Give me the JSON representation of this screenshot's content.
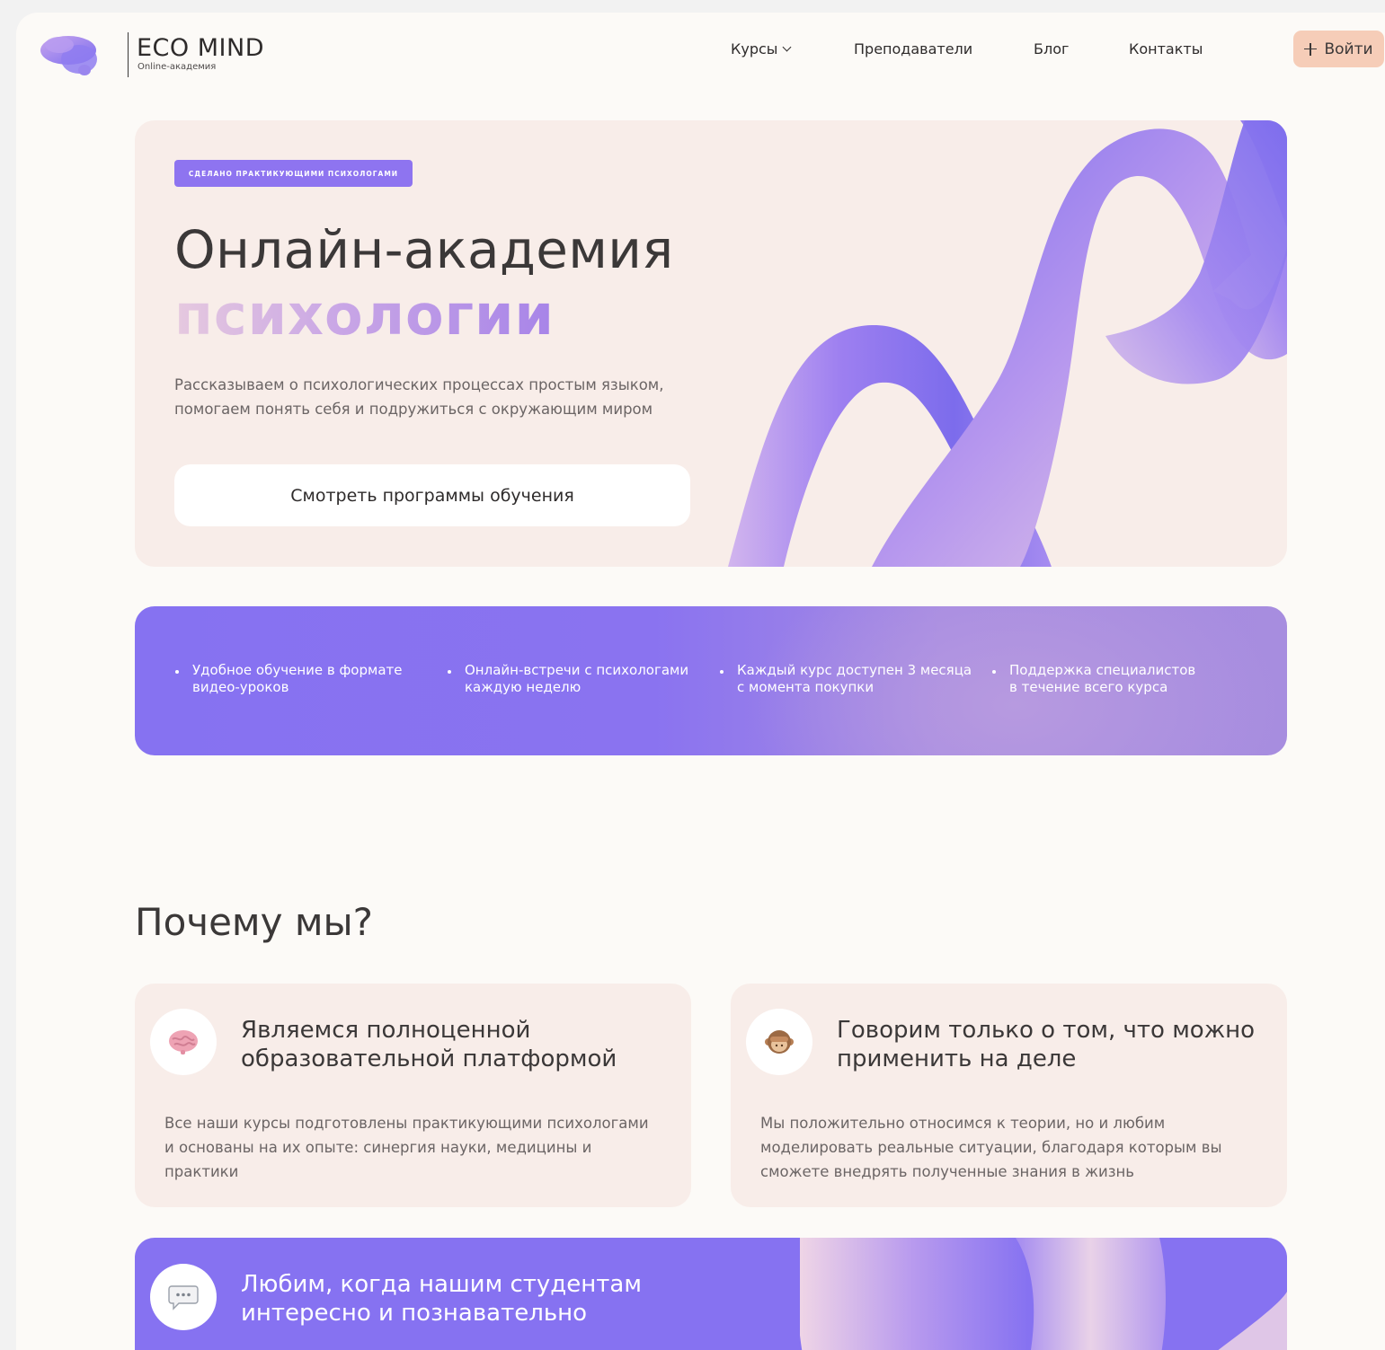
{
  "brand": {
    "name": "ECO MIND",
    "tagline": "Online-академия"
  },
  "nav": {
    "courses": "Курсы",
    "teachers": "Преподаватели",
    "blog": "Блог",
    "contacts": "Контакты",
    "login": "Войти"
  },
  "hero": {
    "badge": "СДЕЛАНО ПРАКТИКУЮЩИМИ ПСИХОЛОГАМИ",
    "title": "Онлайн-академия",
    "title_accent": "психологии",
    "description": [
      "Рассказываем о психологических процессах простым языком,",
      "помогаем понять себя и подружиться с окружающим миром"
    ],
    "cta": "Смотреть программы обучения"
  },
  "features": [
    [
      "Удобное обучение в формате",
      "видео-уроков"
    ],
    [
      "Онлайн-встречи с психологами",
      "каждую неделю"
    ],
    [
      "Каждый курс доступен 3 месяца",
      "с момента покупки"
    ],
    [
      "Поддержка специалистов",
      "в течение всего курса"
    ]
  ],
  "why": {
    "title": "Почему мы?",
    "cards": [
      {
        "icon": "brain-icon",
        "title": [
          "Являемся полноценной",
          "образовательной платформой"
        ],
        "text": [
          "Все наши курсы подготовлены практикующими психологами",
          "и основаны на их опыте: синергия науки, медицины и",
          "практики"
        ]
      },
      {
        "icon": "monkey-icon",
        "title": [
          "Говорим только о том, что можно",
          "применить на деле"
        ],
        "text": [
          "Мы положительно относимся к теории, но и любим",
          "моделировать реальные ситуации, благодаря которым вы",
          "сможете внедрять полученные знания в жизнь"
        ]
      },
      {
        "icon": "speech-bubble-icon",
        "title": [
          "Любим, когда нашим студентам",
          "интересно и познавательно"
        ]
      }
    ]
  },
  "colors": {
    "accent": "#8672f1",
    "login_bg": "#f6cdb8",
    "card_bg": "#f8ede9",
    "page_bg": "#fcfaf7"
  }
}
